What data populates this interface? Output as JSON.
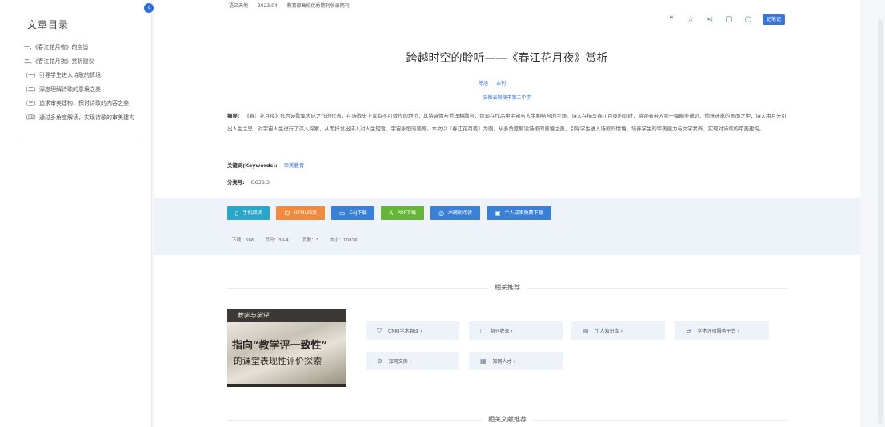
{
  "toc": {
    "title": "文章目录",
    "collapse_icon": "chevron-left-icon",
    "items": [
      "一、《春江花月夜》的主旨",
      "二、《春江花月夜》赏析建议",
      "（一）引导学生进入诗歌的情境",
      "（二）深度理解诗歌的意境之美",
      "（三）追求审美建构，探讨诗歌的内容之美",
      "（四）通过多角度解读，实现诗歌的审美建构"
    ]
  },
  "article": {
    "meta_source": "语文天地",
    "meta_date": "2023.04",
    "meta_extra": "教育部高校优秀期刊收录期刊",
    "title": "跨越时空的聆听——《春江花月夜》赏析",
    "authors": [
      "陈旭",
      "本刊"
    ],
    "org": "安徽省铜陵市第二中学",
    "abstract_label": "摘要:",
    "abstract": "《春江花月夜》作为诗歌集大成之作的代表，在诗歌史上享有不可替代的地位，其将诗情与哲理相融合，体现在作品中宇宙与人生相结合的主题。诗人在描写春江月夜的同时，将读者带入到一幅幽美邈远、惝恍迷离的画面之中，诗人由月光引出人生之思，对宇宙人生进行了深入探索，从而抒发出诗人对人生短暂、宇宙永恒的感慨。本文以《春江花月夜》为例，从多角度解读诗歌的意境之美，引导学生进入诗歌的情境，培养学生的审美能力与文学素养，实现对诗歌的审美建构。",
    "keywords_label": "关键词(Keywords):",
    "keywords": "审美教育",
    "class_label": "分类号:",
    "class_no": "G633.3"
  },
  "toolbar": {
    "icons": [
      "quote-icon",
      "star-icon",
      "share-icon",
      "print-icon",
      "info-icon"
    ],
    "favorite_label": "记笔记"
  },
  "downloads": [
    {
      "label": "手机阅读",
      "color": "#2aa6c8",
      "icon": "phone-icon"
    },
    {
      "label": "HTML阅读",
      "color": "#f08a3c",
      "icon": "html-icon"
    },
    {
      "label": "CAJ下载",
      "color": "#3a80d6",
      "icon": "book-icon"
    },
    {
      "label": "PDF下载",
      "color": "#67b538",
      "icon": "pdf-icon"
    },
    {
      "label": "AI辅助阅读",
      "color": "#3a80d6",
      "icon": "ai-icon"
    },
    {
      "label": "个人成果免费下载",
      "color": "#3a80d6",
      "icon": "download-icon"
    }
  ],
  "stats": {
    "downloads": "下载：666",
    "pages": "页码：39-41",
    "page_count": "页数：3",
    "size": "大小：1087K"
  },
  "related": {
    "title": "相关推荐",
    "thumb_header": "教学与学评",
    "thumb_line1": "指向“教学评一致性”",
    "thumb_line2": "的课堂表现性评价探索",
    "tags": [
      {
        "label": "CNKI学术翻译",
        "icon": "shield-icon"
      },
      {
        "label": "期刊收录",
        "icon": "book-icon"
      },
      {
        "label": "个人知识库",
        "icon": "library-icon"
      },
      {
        "label": "学术评价服务平台",
        "icon": "platform-icon"
      },
      {
        "label": "知网文库",
        "icon": "docs-icon"
      },
      {
        "label": "知网人才",
        "icon": "person-icon"
      }
    ]
  },
  "related_docs": {
    "title": "相关文献推荐"
  }
}
